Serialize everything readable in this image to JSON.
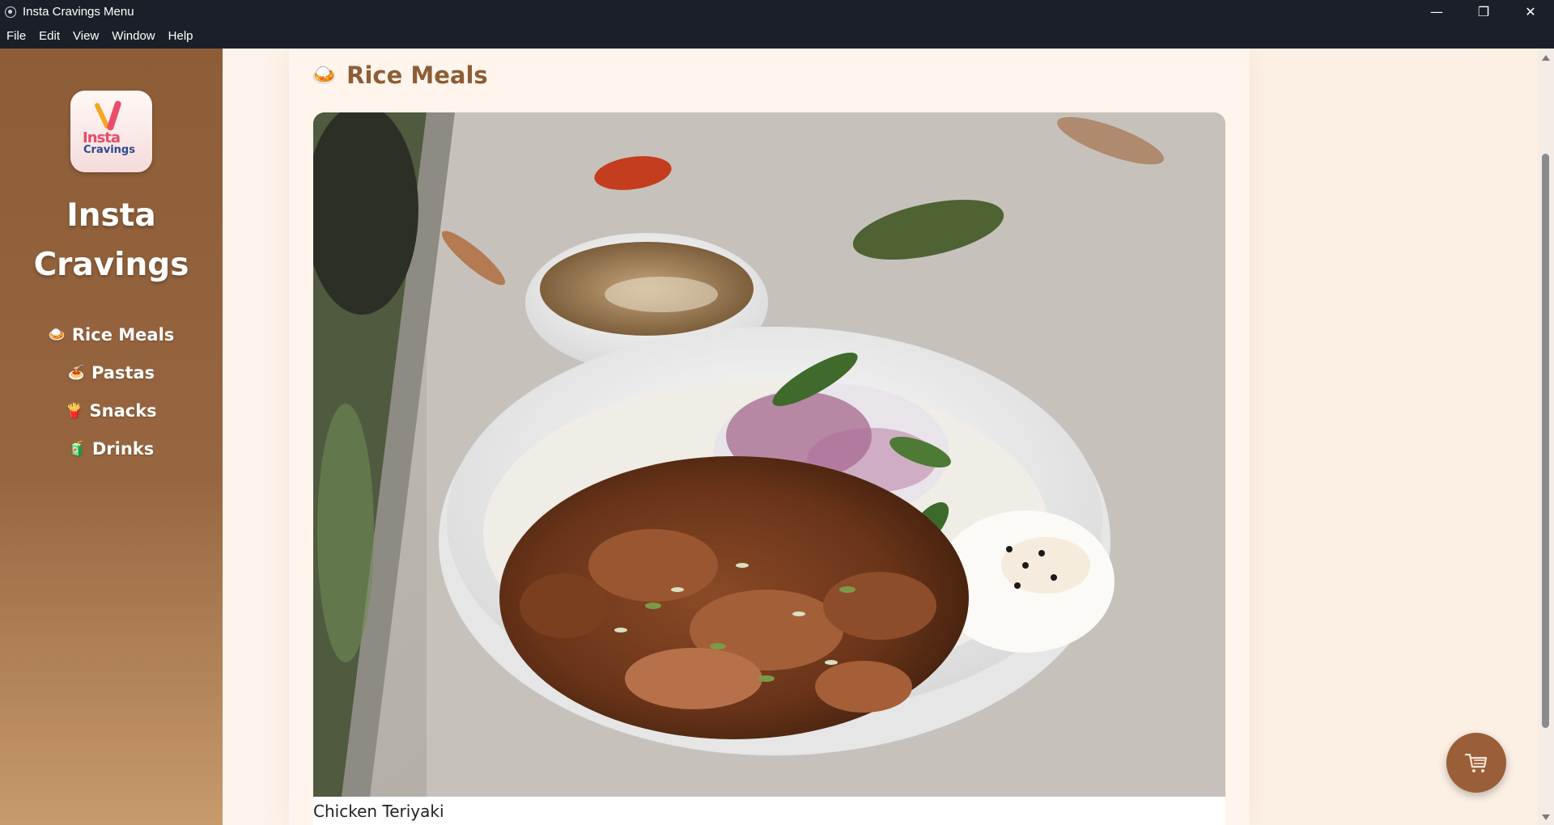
{
  "window": {
    "title": "Insta Cravings Menu",
    "controls": {
      "minimize": "—",
      "restore": "❐",
      "close": "✕"
    }
  },
  "menubar": {
    "items": [
      "File",
      "Edit",
      "View",
      "Window",
      "Help"
    ]
  },
  "sidebar": {
    "logo": {
      "line1": "Insta",
      "line2": "Cravings"
    },
    "brand_line1": "Insta",
    "brand_line2": "Cravings",
    "nav": [
      {
        "emoji": "🍛",
        "label": "Rice Meals"
      },
      {
        "emoji": "🍝",
        "label": "Pastas"
      },
      {
        "emoji": "🍟",
        "label": "Snacks"
      },
      {
        "emoji": "🧃",
        "label": "Drinks"
      }
    ]
  },
  "main": {
    "section": {
      "emoji": "🍛",
      "title": "Rice Meals"
    },
    "items": [
      {
        "name": "Chicken Teriyaki",
        "image": "teriyaki-rice-bowl-photo"
      }
    ]
  },
  "cart": {
    "icon": "cart-icon"
  },
  "colors": {
    "sidebar_top": "#8d5d37",
    "sidebar_bottom": "#c79a6c",
    "accent_brown": "#8d5d37",
    "fab": "#9a5f38",
    "background": "#fcefe3"
  }
}
